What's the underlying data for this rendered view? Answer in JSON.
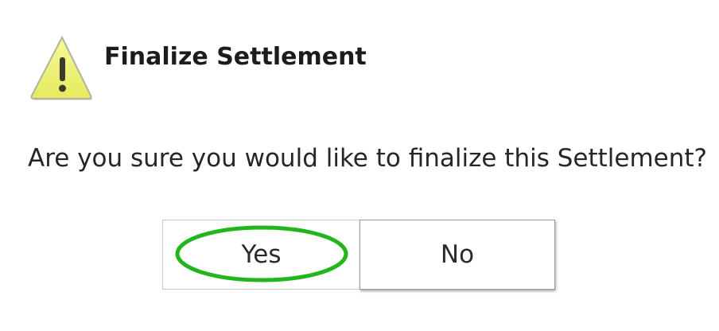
{
  "dialog": {
    "title": "Finalize Settlement",
    "message": "Are you sure you would like to finalize this Settlement?",
    "icon": "warning-icon"
  },
  "buttons": {
    "yes_label": "Yes",
    "no_label": "No"
  },
  "annotation": {
    "highlight_color": "#22b51e",
    "highlighted_button": "Yes"
  },
  "colors": {
    "warning_fill": "#eef17a",
    "warning_outline": "#b7b7b7"
  }
}
